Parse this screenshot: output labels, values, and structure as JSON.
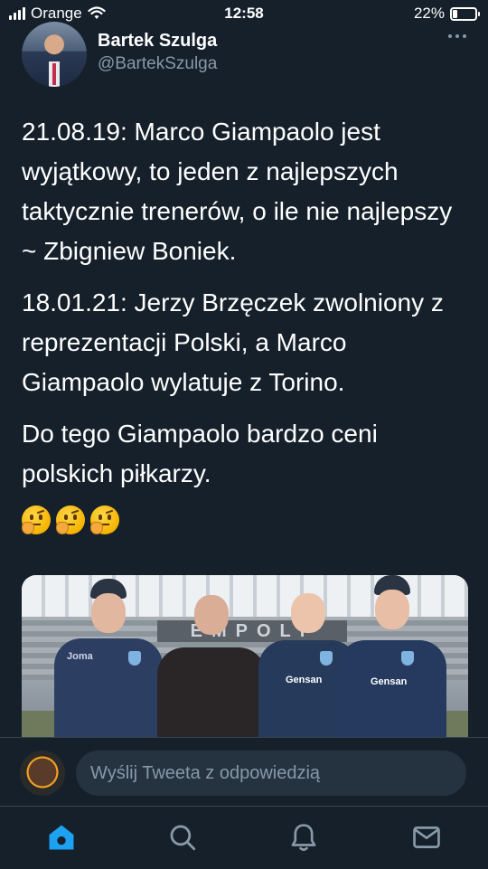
{
  "status_bar": {
    "carrier": "Orange",
    "time": "12:58",
    "battery": "22%",
    "battery_level": 0.22,
    "signal_bars": 4,
    "wifi_icon": "wifi-icon"
  },
  "tweet": {
    "author_name": "Bartek Szulga",
    "author_handle": "@BartekSzulga",
    "paragraphs": [
      "21.08.19: Marco Giampaolo jest wyjątkowy, to jeden z najlepszych taktycznie trenerów, o ile nie najlepszy ~ Zbigniew Boniek.",
      "18.01.21: Jerzy Brzęczek zwolniony z reprezentacji Polski, a Marco Giampaolo wylatuje z Torino.",
      "Do tego Giampaolo bardzo ceni polskich piłkarzy."
    ],
    "emojis": [
      "thinking-face",
      "thinking-face",
      "thinking-face"
    ],
    "more_icon": "more-horizontal-icon",
    "media": {
      "banner_text": "EMPOLI",
      "jersey_text_1": "Gensan",
      "jersey_text_2": "Gensan",
      "jersey_brand": "Joma"
    }
  },
  "reply": {
    "placeholder": "Wyślij Tweeta z odpowiedzią"
  },
  "tab_bar": {
    "items": [
      {
        "icon": "home-icon",
        "active": true,
        "color": "#1da1f2"
      },
      {
        "icon": "search-icon",
        "active": false,
        "color": "#8899a6"
      },
      {
        "icon": "notifications-icon",
        "active": false,
        "color": "#8899a6"
      },
      {
        "icon": "messages-icon",
        "active": false,
        "color": "#8899a6"
      }
    ]
  },
  "colors": {
    "background": "#15202b",
    "accent": "#1da1f2",
    "secondary_text": "#8899a6"
  }
}
